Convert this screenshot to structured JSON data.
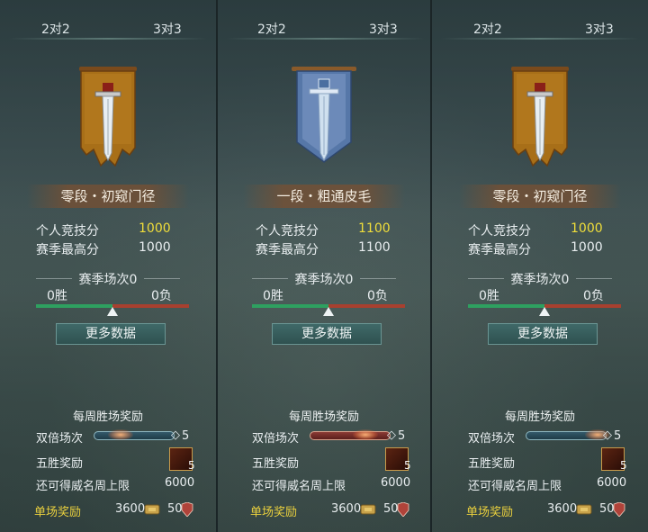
{
  "panels": [
    {
      "tabs": {
        "two": "2对2",
        "three": "3对3"
      },
      "rank": "零段・初窥门径",
      "banner": "gold-sword-banner-icon",
      "stats": {
        "personal_label": "个人竞技分",
        "personal_value": "1000",
        "season_high_label": "赛季最高分",
        "season_high_value": "1000"
      },
      "season": {
        "label": "赛季场次0",
        "wins": "0胜",
        "losses": "0负"
      },
      "more_button": "更多数据",
      "rewards": {
        "title": "每周胜场奖励",
        "double_label": "双倍场次",
        "double_count": "5",
        "five_win_label": "五胜奖励",
        "five_win_count": "5",
        "cap_label": "还可得威名周上限",
        "cap_value": "6000",
        "single_label": "单场奖励",
        "single_coin": "3600",
        "single_honor": "50"
      }
    },
    {
      "tabs": {
        "two": "2对2",
        "three": "3对3"
      },
      "rank": "一段・粗通皮毛",
      "banner": "blue-sword-banner-icon",
      "stats": {
        "personal_label": "个人竞技分",
        "personal_value": "1100",
        "season_high_label": "赛季最高分",
        "season_high_value": "1100"
      },
      "season": {
        "label": "赛季场次0",
        "wins": "0胜",
        "losses": "0负"
      },
      "more_button": "更多数据",
      "rewards": {
        "title": "每周胜场奖励",
        "double_label": "双倍场次",
        "double_count": "5",
        "five_win_label": "五胜奖励",
        "five_win_count": "5",
        "cap_label": "还可得威名周上限",
        "cap_value": "6000",
        "single_label": "单场奖励",
        "single_coin": "3600",
        "single_honor": "50"
      }
    },
    {
      "tabs": {
        "two": "2对2",
        "three": "3对3"
      },
      "rank": "零段・初窥门径",
      "banner": "gold-sword-banner-icon",
      "stats": {
        "personal_label": "个人竞技分",
        "personal_value": "1000",
        "season_high_label": "赛季最高分",
        "season_high_value": "1000"
      },
      "season": {
        "label": "赛季场次0",
        "wins": "0胜",
        "losses": "0负"
      },
      "more_button": "更多数据",
      "rewards": {
        "title": "每周胜场奖励",
        "double_label": "双倍场次",
        "double_count": "5",
        "five_win_label": "五胜奖励",
        "five_win_count": "5",
        "cap_label": "还可得威名周上限",
        "cap_value": "6000",
        "single_label": "单场奖励",
        "single_coin": "3600",
        "single_honor": "50"
      }
    }
  ],
  "colors": {
    "gold_banner": "#a86f18",
    "blue_banner": "#5677a8",
    "score_highlight": "#f0de3a",
    "win_bar": "#2ea060",
    "loss_bar": "#a8402f",
    "reward_label": "#e8cf3e"
  }
}
